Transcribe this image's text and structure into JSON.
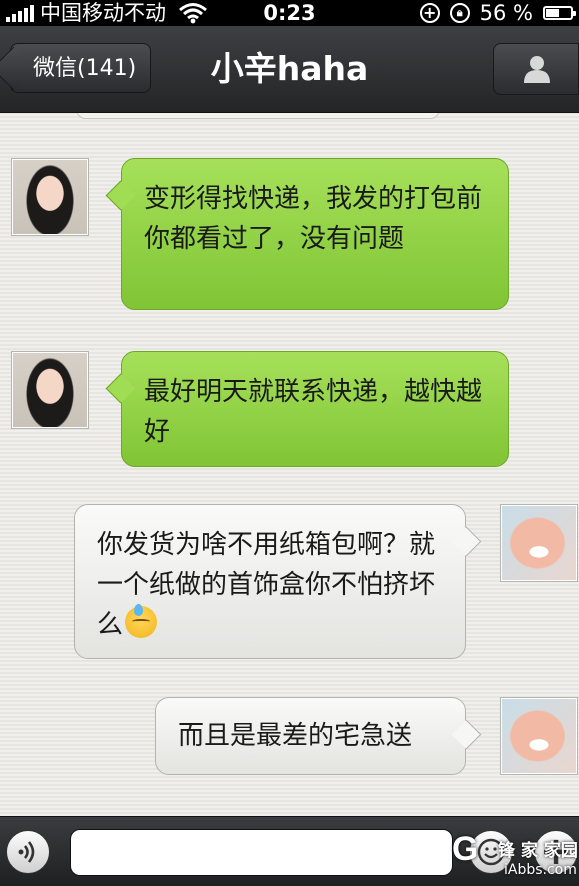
{
  "status_bar": {
    "carrier": "中国移动",
    "network": "不动",
    "time": "0:23",
    "battery": "56 %",
    "battery_level": 0.56,
    "icons": [
      "signal-icon",
      "wifi-icon",
      "add-circle-icon",
      "rotation-lock-icon",
      "battery-icon"
    ]
  },
  "nav": {
    "back_label": "微信(141)",
    "title": "小辛haha",
    "profile_icon": "person-icon"
  },
  "messages": [
    {
      "from": "contact",
      "text": "变形得找快递，我发的打包前你都看过了，没有问题"
    },
    {
      "from": "contact",
      "text": "最好明天就联系快递，越快越好"
    },
    {
      "from": "me",
      "text": "你发货为啥不用纸箱包啊？就一个纸做的首饰盒你不怕挤坏么",
      "emoji": "sweat-smile-emoji"
    },
    {
      "from": "me",
      "text": "而且是最差的宅急送"
    }
  ],
  "input_bar": {
    "value": "",
    "icons": [
      "voice-icon",
      "smiley-icon",
      "plus-icon"
    ]
  },
  "watermark": {
    "logo": "G",
    "site_cn": "锋 家 家园",
    "site_url": "iAbbs.com"
  },
  "colors": {
    "incoming_bubble": "#92d147",
    "outgoing_bubble": "#efefed",
    "nav_bar": "#2e3033",
    "status_bar": "#000000"
  }
}
